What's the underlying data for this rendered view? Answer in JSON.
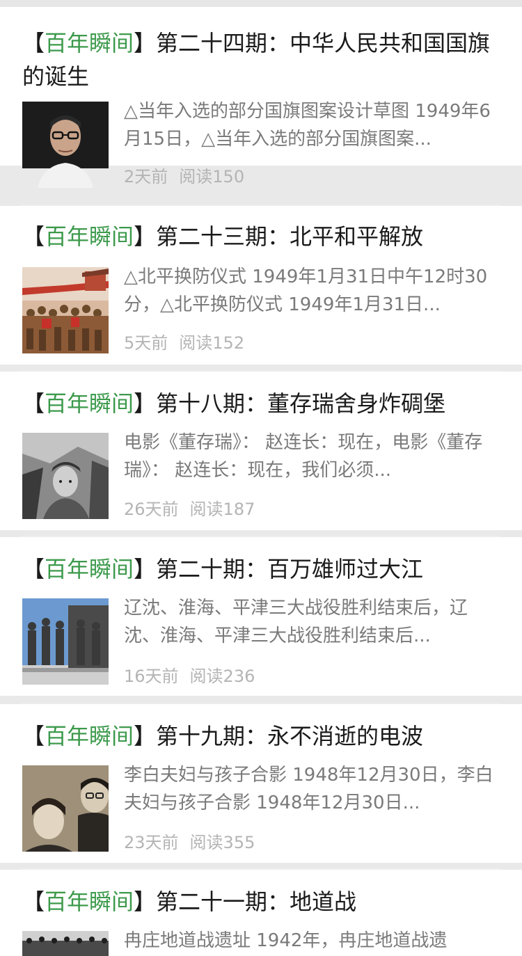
{
  "feed": {
    "articles": [
      {
        "tag_open": "【",
        "tag": "百年瞬间",
        "tag_close": "】",
        "title": "第二十四期：中华人民共和国国旗的诞生",
        "summary": "△当年入选的部分国旗图案设计草图 1949年6月15日，△当年入选的部分国旗图案...",
        "time": "2天前",
        "reads": "阅读150",
        "thumb_icon": "portrait-man-glasses"
      },
      {
        "tag_open": "【",
        "tag": "百年瞬间",
        "tag_close": "】",
        "title": "第二十三期：北平和平解放",
        "summary": "△北平换防仪式 1949年1月31日中午12时30分，△北平换防仪式 1949年1月31日...",
        "time": "5天前",
        "reads": "阅读152",
        "thumb_icon": "crowd-parade-painting"
      },
      {
        "tag_open": "【",
        "tag": "百年瞬间",
        "tag_close": "】",
        "title": "第十八期：董存瑞舍身炸碉堡",
        "summary": "电影《董存瑞》： 赵连长：现在，电影《董存瑞》： 赵连长：现在，我们必须...",
        "time": "26天前",
        "reads": "阅读187",
        "thumb_icon": "soldier-film-still"
      },
      {
        "tag_open": "【",
        "tag": "百年瞬间",
        "tag_close": "】",
        "title": "第二十期：百万雄师过大江",
        "summary": "辽沈、淮海、平津三大战役胜利结束后，辽沈、淮海、平津三大战役胜利结束后...",
        "time": "16天前",
        "reads": "阅读236",
        "thumb_icon": "statue-monument"
      },
      {
        "tag_open": "【",
        "tag": "百年瞬间",
        "tag_close": "】",
        "title": "第十九期：永不消逝的电波",
        "summary": "李白夫妇与孩子合影 1948年12月30日，李白夫妇与孩子合影 1948年12月30日...",
        "time": "23天前",
        "reads": "阅读355",
        "thumb_icon": "family-photo"
      },
      {
        "tag_open": "【",
        "tag": "百年瞬间",
        "tag_close": "】",
        "title": "第二十一期：地道战",
        "summary": "冉庄地道战遗址 1942年，冉庄地道战遗",
        "time": "",
        "reads": "",
        "thumb_icon": "tunnel-war-soldiers"
      }
    ]
  }
}
